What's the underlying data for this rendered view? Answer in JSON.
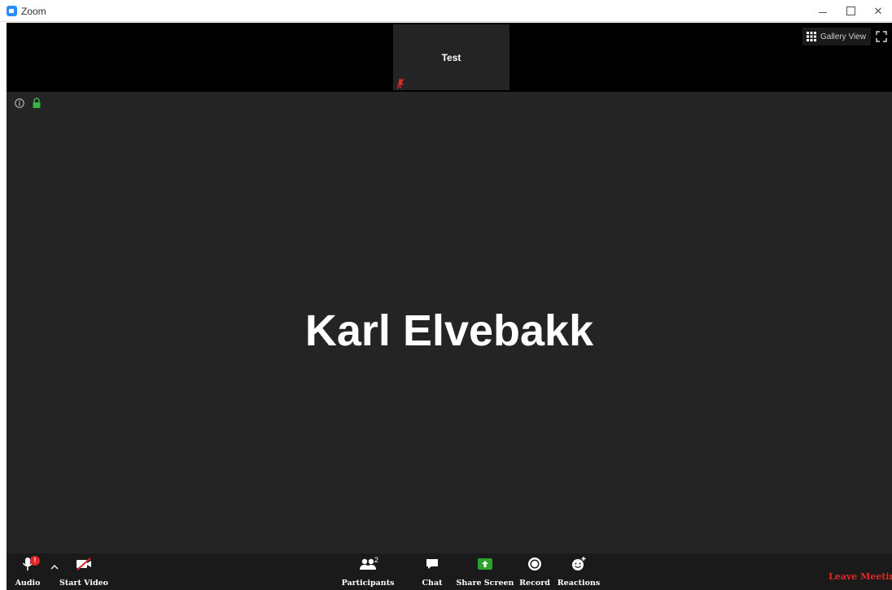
{
  "window": {
    "title": "Zoom",
    "min_glyph": "–",
    "max_glyph": "□",
    "close_glyph": "✕"
  },
  "strip": {
    "tile_name": "Test",
    "gallery_view_label": "Gallery View"
  },
  "main": {
    "speaker_name": "Karl Elvebakk"
  },
  "toolbar": {
    "audio_label": "Audio",
    "audio_badge": "!",
    "chevron": "^",
    "start_video_label": "Start Video",
    "participants_label": "Participants",
    "participants_count": "2",
    "chat_label": "Chat",
    "share_screen_label": "Share Screen",
    "record_label": "Record",
    "reactions_label": "Reactions",
    "leave_label": "Leave Meeting"
  },
  "colors": {
    "accent_blue": "#2d8cff",
    "share_green": "#29a329",
    "leave_red": "#e02828",
    "lock_green": "#3cb043",
    "main_bg": "#242424"
  }
}
